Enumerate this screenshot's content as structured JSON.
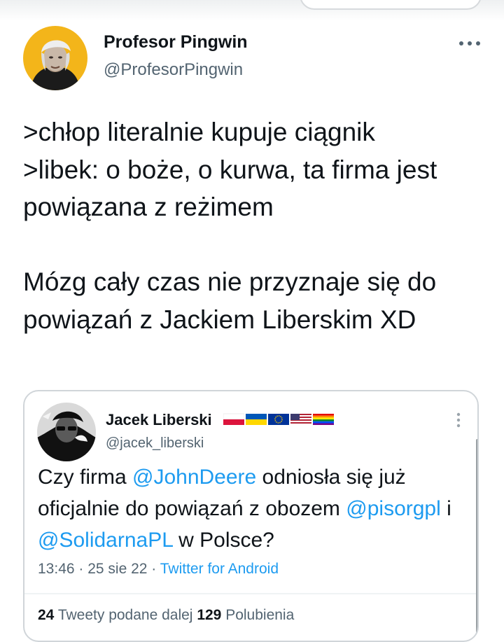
{
  "tweet": {
    "author_name": "Profesor Pingwin",
    "author_handle": "@ProfesorPingwin",
    "text": ">chłop literalnie kupuje ciągnik\n>libek: o boże, o kurwa, ta firma jest powiązana z reżimem\n\nMózg cały czas nie przyznaje się do powiązań z Jackiem Liberskim XD",
    "more_icon": "more-horizontal-icon"
  },
  "quoted_tweet": {
    "author_name": "Jacek Liberski",
    "author_handle": "@jacek_liberski",
    "flags": [
      "poland-flag",
      "ukraine-flag",
      "eu-flag",
      "usa-flag",
      "rainbow-flag"
    ],
    "text_parts": [
      {
        "text": "Czy firma ",
        "mention": false
      },
      {
        "text": "@JohnDeere",
        "mention": true
      },
      {
        "text": " odniosła się już oficjalnie do powiązań z obozem ",
        "mention": false
      },
      {
        "text": "@pisorgpl",
        "mention": true
      },
      {
        "text": " i ",
        "mention": false
      },
      {
        "text": "@SolidarnaPL",
        "mention": true
      },
      {
        "text": " w Polsce?",
        "mention": false
      }
    ],
    "time": "13:46",
    "separator": " · ",
    "date": "25 sie 22",
    "source": "Twitter for Android",
    "retweets_count": "24",
    "retweets_label": "Tweety podane dalej",
    "likes_count": "129",
    "likes_label": "Polubienia"
  },
  "colors": {
    "link": "#1d9bf0",
    "secondary_text": "#536471",
    "primary_text": "#0f1419"
  }
}
